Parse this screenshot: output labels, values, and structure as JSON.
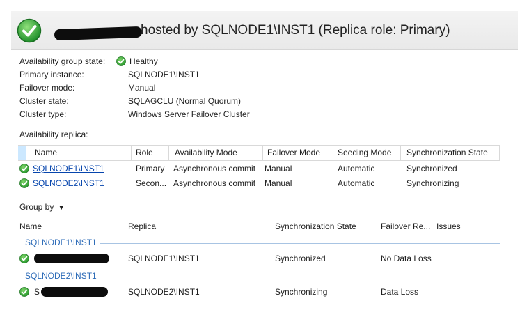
{
  "header": {
    "title": "hosted by SQLNODE1\\INST1 (Replica role: Primary)",
    "status_icon": "check-circle-icon"
  },
  "properties": {
    "ag_state": {
      "label": "Availability group state:",
      "value": "Healthy"
    },
    "primary_instance": {
      "label": "Primary instance:",
      "value": "SQLNODE1\\INST1"
    },
    "failover_mode": {
      "label": "Failover mode:",
      "value": "Manual"
    },
    "cluster_state": {
      "label": "Cluster state:",
      "value": "SQLAGCLU (Normal Quorum)"
    },
    "cluster_type": {
      "label": "Cluster type:",
      "value": "Windows Server Failover Cluster"
    }
  },
  "replicas": {
    "section_label": "Availability replica:",
    "columns": [
      "Name",
      "Role",
      "Availability Mode",
      "Failover Mode",
      "Seeding Mode",
      "Synchronization State"
    ],
    "rows": [
      {
        "name": "SQLNODE1\\INST1",
        "role": "Primary",
        "availability_mode": "Asynchronous commit",
        "failover_mode": "Manual",
        "seeding_mode": "Automatic",
        "sync_state": "Synchronized"
      },
      {
        "name": "SQLNODE2\\INST1",
        "role": "Secon...",
        "availability_mode": "Asynchronous commit",
        "failover_mode": "Manual",
        "seeding_mode": "Automatic",
        "sync_state": "Synchronizing"
      }
    ]
  },
  "group_by": {
    "label": "Group by",
    "icon": "caret-down-icon"
  },
  "databases": {
    "columns": [
      "Name",
      "Replica",
      "Synchronization State",
      "Failover Re...",
      "Issues"
    ],
    "groups": [
      {
        "header": "SQLNODE1\\INST1",
        "rows": [
          {
            "name_partial": "",
            "replica": "SQLNODE1\\INST1",
            "sync_state": "Synchronized",
            "failover_readiness": "No Data Loss",
            "issues": ""
          }
        ]
      },
      {
        "header": "SQLNODE2\\INST1",
        "rows": [
          {
            "name_partial": "S",
            "replica": "SQLNODE2\\INST1",
            "sync_state": "Synchronizing",
            "failover_readiness": "Data Loss",
            "issues": ""
          }
        ]
      }
    ]
  },
  "colors": {
    "check_green": "#3aaa35",
    "link": "#0645ad",
    "group_header": "#2e6cb8",
    "selection": "#cce8ff"
  }
}
